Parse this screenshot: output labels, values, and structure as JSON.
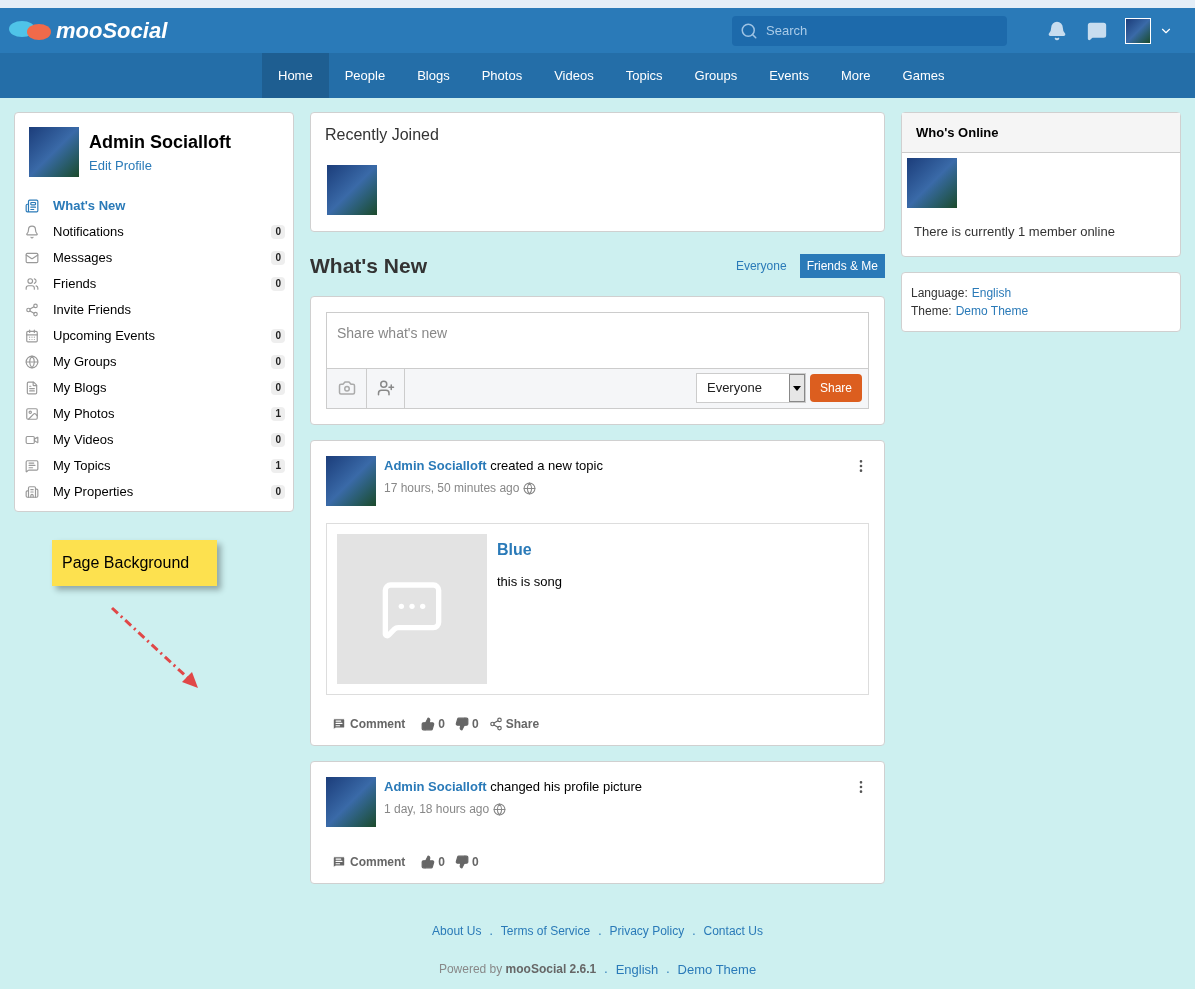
{
  "header": {
    "logo_text": "mooSocial",
    "search": {
      "placeholder": "Search"
    }
  },
  "nav": [
    {
      "label": "Home",
      "selected": true
    },
    {
      "label": "People",
      "selected": false
    },
    {
      "label": "Blogs",
      "selected": false
    },
    {
      "label": "Photos",
      "selected": false
    },
    {
      "label": "Videos",
      "selected": false
    },
    {
      "label": "Topics",
      "selected": false
    },
    {
      "label": "Groups",
      "selected": false
    },
    {
      "label": "Events",
      "selected": false
    },
    {
      "label": "More",
      "selected": false
    },
    {
      "label": "Games",
      "selected": false
    }
  ],
  "profile": {
    "name": "Admin Socialloft",
    "edit_link": "Edit Profile",
    "menu": [
      {
        "label": "What's New",
        "selected": true
      },
      {
        "label": "Notifications",
        "count": "0",
        "selected": false
      },
      {
        "label": "Messages",
        "count": "0",
        "selected": false
      },
      {
        "label": "Friends",
        "count": "0",
        "selected": false
      },
      {
        "label": "Invite Friends",
        "selected": false
      },
      {
        "label": "Upcoming Events",
        "count": "0",
        "selected": false
      },
      {
        "label": "My Groups",
        "count": "0",
        "selected": false
      },
      {
        "label": "My Blogs",
        "count": "0",
        "selected": false
      },
      {
        "label": "My Photos",
        "count": "1",
        "selected": false
      },
      {
        "label": "My Videos",
        "count": "0",
        "selected": false
      },
      {
        "label": "My Topics",
        "count": "1",
        "selected": false
      },
      {
        "label": "My Properties",
        "count": "0",
        "selected": false
      }
    ]
  },
  "annotation": {
    "note": "Page Background"
  },
  "recently_joined": {
    "title": "Recently Joined"
  },
  "feed": {
    "title": "What's New",
    "filters": [
      {
        "label": "Everyone",
        "selected": false
      },
      {
        "label": "Friends & Me",
        "selected": true
      }
    ],
    "composer": {
      "placeholder": "Share what's new",
      "privacy": "Everyone",
      "share": "Share"
    },
    "posts": [
      {
        "author": "Admin Socialloft",
        "action": "created a new topic",
        "time": "17 hours, 50 minutes ago",
        "attachment": {
          "title": "Blue",
          "text": "this is song"
        },
        "comment": "Comment",
        "likes": "0",
        "dislikes": "0",
        "share": "Share"
      },
      {
        "author": "Admin Socialloft",
        "action": "changed his profile picture",
        "time": "1 day, 18 hours ago",
        "comment": "Comment",
        "likes": "0",
        "dislikes": "0"
      }
    ]
  },
  "who_online": {
    "title": "Who's Online",
    "text": "There is currently 1 member online"
  },
  "site_info": {
    "language_label": "Language:",
    "language": "English",
    "theme_label": "Theme:",
    "theme": "Demo Theme"
  },
  "footer": {
    "separator": ".",
    "links": [
      "About Us",
      "Terms of Service",
      "Privacy Policy",
      "Contact Us"
    ],
    "powered": "Powered by **mooSocial 2.6.1**",
    "bottom_links": [
      "English",
      "Demo Theme"
    ]
  }
}
